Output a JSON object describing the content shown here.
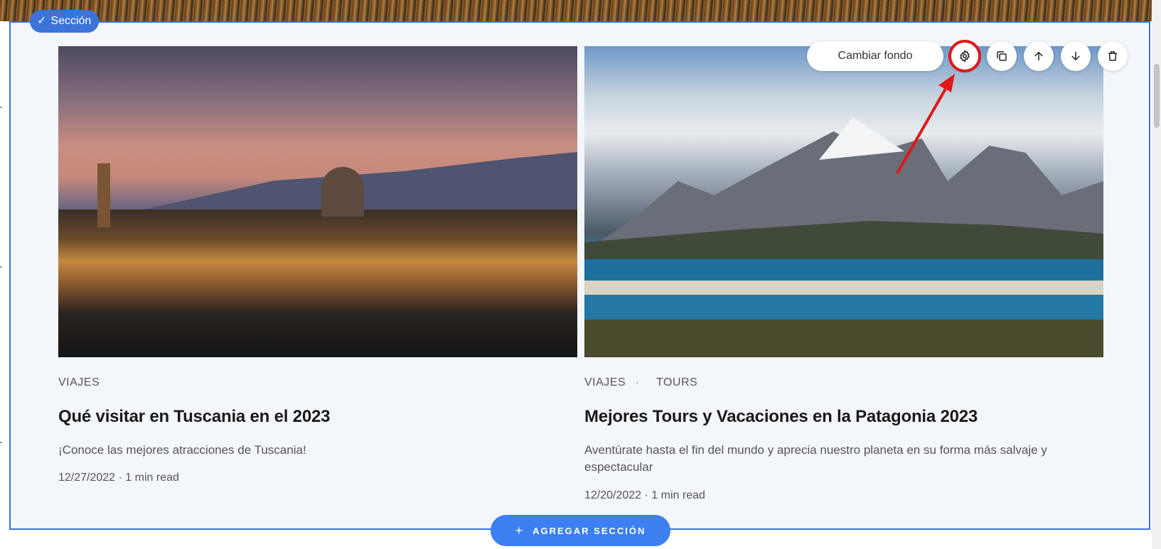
{
  "section": {
    "badge_label": "Sección"
  },
  "toolbar": {
    "change_background_label": "Cambiar fondo",
    "settings_icon": "gear-icon",
    "duplicate_icon": "copy-icon",
    "move_up_icon": "arrow-up-icon",
    "move_down_icon": "arrow-down-icon",
    "delete_icon": "trash-icon"
  },
  "posts": [
    {
      "categories": [
        "VIAJES"
      ],
      "title": "Qué visitar en Tuscania en el 2023",
      "description": "¡Conoce las mejores atracciones de Tuscania!",
      "meta": "12/27/2022 · 1 min read"
    },
    {
      "categories": [
        "VIAJES",
        "TOURS"
      ],
      "category_separator": "·",
      "title": "Mejores Tours y Vacaciones en la Patagonia 2023",
      "description": "Aventúrate hasta el fin del mundo y aprecia nuestro planeta en su forma más salvaje y espectacular",
      "meta": "12/20/2022 · 1 min read"
    }
  ],
  "add_section": {
    "plus": "+",
    "label": "AGREGAR SECCIÓN"
  },
  "colors": {
    "accent": "#3b73d9",
    "add_button": "#3b7ff0",
    "highlight": "#e01818",
    "section_bg": "#f3f6fa"
  }
}
